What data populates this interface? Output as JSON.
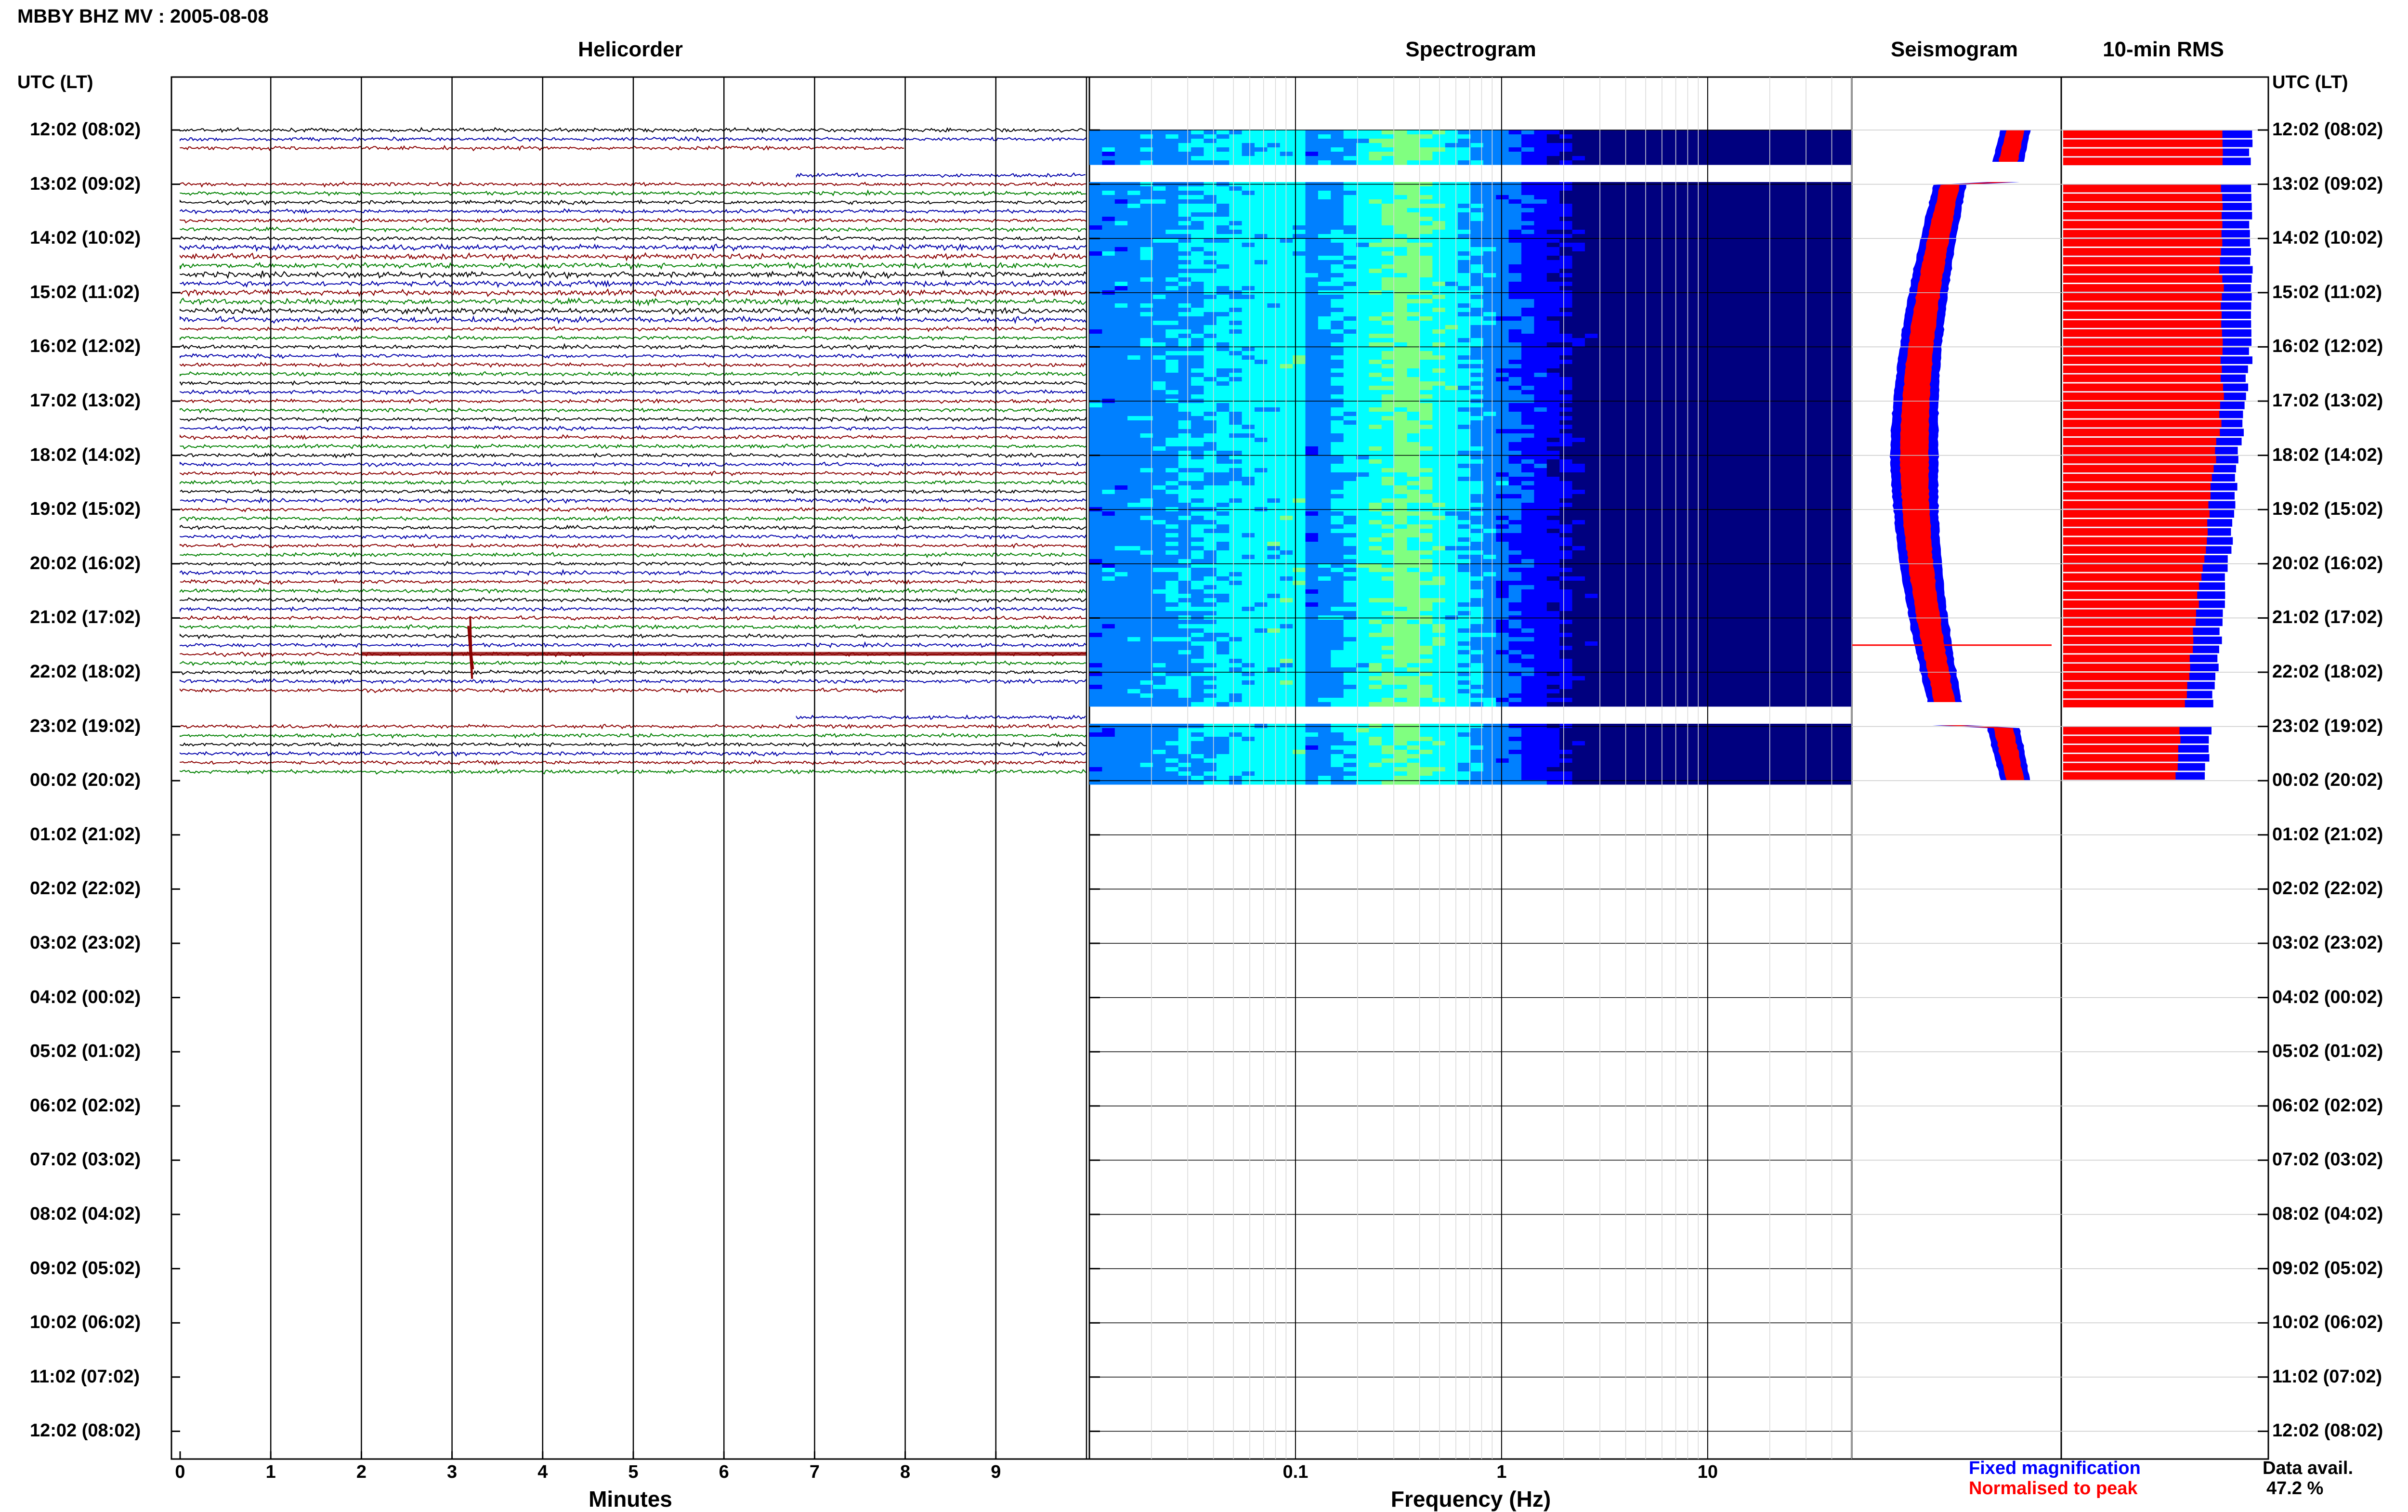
{
  "header": {
    "title": "MBBY BHZ MV : 2005-08-08",
    "utc_left": "UTC (LT)",
    "utc_right": "UTC (LT)"
  },
  "panels": {
    "helicorder": "Helicorder",
    "spectrogram": "Spectrogram",
    "seismogram": "Seismogram",
    "rms": "10-min RMS"
  },
  "legend": {
    "fixed": "Fixed magnification",
    "normalised": "Normalised to peak",
    "fixed_color": "#0000ff",
    "normalised_color": "#ff0000"
  },
  "availability": {
    "label": "Data avail.",
    "value": "47.2 %"
  },
  "chart_data": [
    {
      "type": "line",
      "name": "helicorder",
      "title": "Helicorder",
      "xlabel": "Minutes",
      "ylabel": "UTC (LT)",
      "x_ticks": [
        "0",
        "1",
        "2",
        "3",
        "4",
        "5",
        "6",
        "7",
        "8",
        "9"
      ],
      "xlim": [
        0,
        10
      ],
      "hour_labels": [
        "12:02 (08:02)",
        "13:02 (09:02)",
        "14:02 (10:02)",
        "15:02 (11:02)",
        "16:02 (12:02)",
        "17:02 (13:02)",
        "18:02 (14:02)",
        "19:02 (15:02)",
        "20:02 (16:02)",
        "21:02 (17:02)",
        "22:02 (18:02)",
        "23:02 (19:02)",
        "00:02 (20:02)",
        "01:02 (21:02)",
        "02:02 (22:02)",
        "03:02 (23:02)",
        "04:02 (00:02)",
        "05:02 (01:02)",
        "06:02 (02:02)",
        "07:02 (03:02)",
        "08:02 (04:02)",
        "09:02 (05:02)",
        "10:02 (06:02)",
        "11:02 (07:02)",
        "12:02 (08:02)"
      ],
      "trace_colors": [
        "#000000",
        "#0000aa",
        "#8b0000",
        "#008000"
      ],
      "data_hours": [
        0,
        12
      ],
      "gap_hours": [
        [
          0.5,
          1.0
        ],
        [
          10.5,
          11.0
        ]
      ],
      "event": {
        "hour": 9.5,
        "minute": 3.2
      }
    },
    {
      "type": "heatmap",
      "name": "spectrogram",
      "title": "Spectrogram",
      "xlabel": "Frequency (Hz)",
      "x_scale": "log",
      "xlim": [
        0.01,
        50
      ],
      "x_ticks": [
        "0.1",
        "1",
        "10"
      ],
      "x_tick_values": [
        0.1,
        1,
        10
      ],
      "peak_frequency_hz": [
        0.2,
        0.6
      ],
      "colormap": [
        "#00007f",
        "#0000ff",
        "#0080ff",
        "#00ffff",
        "#80ff80",
        "#ffff00",
        "#ff8000",
        "#ff0000"
      ]
    },
    {
      "type": "area",
      "name": "seismogram",
      "title": "Seismogram",
      "series": [
        {
          "name": "Fixed magnification",
          "color": "#0000ff"
        },
        {
          "name": "Normalised to peak",
          "color": "#ff0000"
        }
      ]
    },
    {
      "type": "bar",
      "name": "rms",
      "title": "10-min RMS",
      "series": [
        {
          "name": "Fixed magnification",
          "color": "#0000ff"
        },
        {
          "name": "Normalised to peak",
          "color": "#ff0000"
        }
      ]
    }
  ]
}
